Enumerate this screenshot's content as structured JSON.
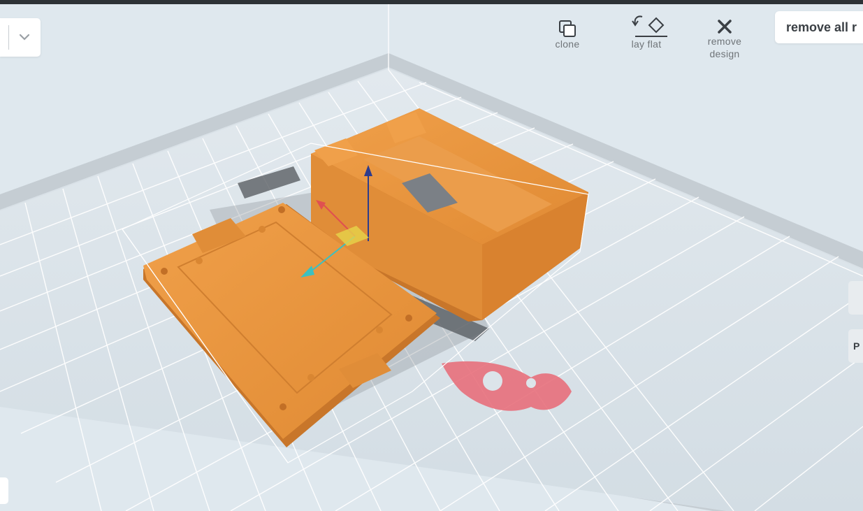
{
  "toolbar": {
    "clone_label": "clone",
    "lay_flat_label": "lay flat",
    "remove_design_label_line1": "remove",
    "remove_design_label_line2": "design",
    "remove_all_label": "remove all r"
  },
  "side_panel": {
    "tab_label": "P"
  },
  "colors": {
    "model": "#e8963f",
    "bed": "#dde5eb",
    "grid": "#ffffff",
    "rocket_logo": "#e8707c",
    "brand_text": "#5a5f64"
  },
  "icons": {
    "clone": "clone-icon",
    "lay_flat": "lay-flat-icon",
    "remove": "close-icon",
    "dropdown": "chevron-down-icon"
  }
}
